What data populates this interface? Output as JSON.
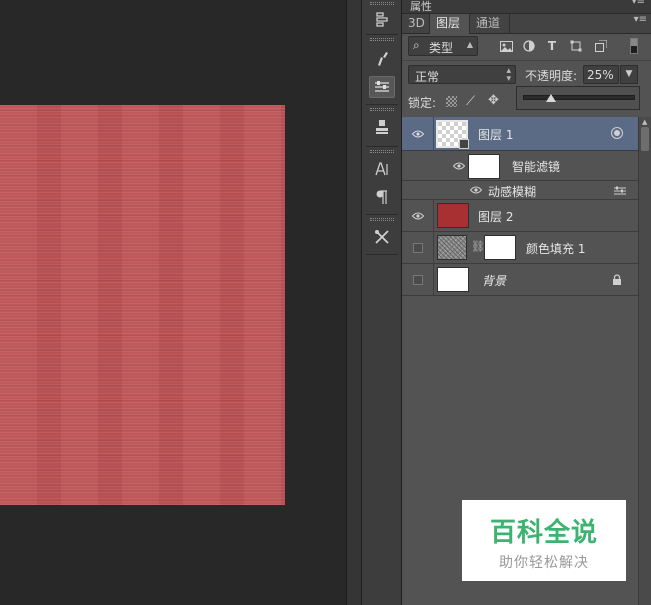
{
  "panel": {
    "title": "属性",
    "tabs": [
      {
        "label": "3D"
      },
      {
        "label": "图层"
      },
      {
        "label": "通道"
      }
    ],
    "filter": {
      "kind_label": "类型",
      "search_glyph": "⌕"
    },
    "blend_mode": "正常",
    "opacity": {
      "label": "不透明度:",
      "value": "25%",
      "slider_fraction": 0.25
    },
    "lock": {
      "label": "锁定:"
    }
  },
  "layers": [
    {
      "name": "图层 1",
      "visible": true,
      "selected": true,
      "thumb": "transparent",
      "smart_object": true
    },
    {
      "name": "智能滤镜",
      "sub": true
    },
    {
      "name": "动感模糊",
      "filter": true
    },
    {
      "name": "图层 2",
      "visible": true,
      "thumb_color": "#a83032"
    },
    {
      "name": "颜色填充 1",
      "visible": false
    },
    {
      "name": "背景",
      "visible": false,
      "locked": true
    }
  ],
  "colors": {
    "document_red": "#bd5356",
    "layer2_red": "#a83032",
    "selected_row": "#5b6b86",
    "watermark_green": "#3cb371"
  },
  "icons": {
    "dock": [
      "history-icon",
      "brush-presets-icon",
      "adjustments-icon",
      "clone-source-icon",
      "character-icon",
      "paragraph-icon",
      "tool-presets-icon"
    ]
  },
  "watermark": {
    "title": "百科全说",
    "subtitle": "助你轻松解决"
  }
}
